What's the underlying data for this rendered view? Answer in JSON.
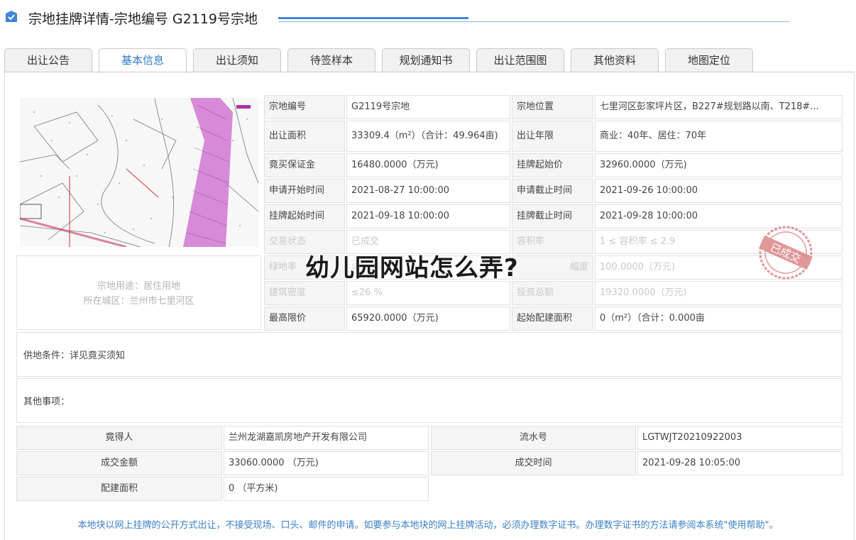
{
  "header": {
    "title": "宗地挂牌详情-宗地编号 G2119号宗地",
    "icon": "checkbox-icon"
  },
  "tabs": [
    {
      "label": "出让公告",
      "active": false
    },
    {
      "label": "基本信息",
      "active": true
    },
    {
      "label": "出让须知",
      "active": false
    },
    {
      "label": "待签样本",
      "active": false
    },
    {
      "label": "规划通知书",
      "active": false
    },
    {
      "label": "出让范围图",
      "active": false
    },
    {
      "label": "其他资料",
      "active": false
    },
    {
      "label": "地图定位",
      "active": false
    }
  ],
  "parcel_info": {
    "use": "宗地用途：居住用地",
    "district": "所在城区：兰州市七里河区"
  },
  "fields": {
    "parcel_no": {
      "label": "宗地编号",
      "value": "G2119号宗地"
    },
    "location": {
      "label": "宗地位置",
      "value": "七里河区彭家坪片区，B227#规划路以南、T218#..."
    },
    "area": {
      "label": "出让面积",
      "value": "33309.4（m²）（合计：49.964亩)"
    },
    "term": {
      "label": "出让年限",
      "value": "商业：40年、居住：70年"
    },
    "deposit": {
      "label": "竟买保证金",
      "value": "16480.0000（万元)"
    },
    "start_price": {
      "label": "挂牌起始价",
      "value": "32960.0000（万元)"
    },
    "apply_start": {
      "label": "申请开始时间",
      "value": "2021-08-27 10:00:00"
    },
    "apply_end": {
      "label": "申请截止时间",
      "value": "2021-09-26 10:00:00"
    },
    "list_start": {
      "label": "挂牌起始时间",
      "value": "2021-09-18 10:00:00"
    },
    "list_end": {
      "label": "挂牌截止时间",
      "value": "2021-09-28 10:00:00"
    },
    "status": {
      "label": "交易状态",
      "value": "已成交"
    },
    "far": {
      "label": "容积率",
      "value": "1 ≤ 容积率 ≤ 2.9"
    },
    "green": {
      "label": "绿地率",
      "value": "≥35 %"
    },
    "increment": {
      "label": "幅度",
      "value": "100.0000（万元)"
    },
    "density": {
      "label": "建筑密度",
      "value": "≤26 %"
    },
    "investment": {
      "label": "投资总额",
      "value": "19320.0000（万元)"
    },
    "max_price": {
      "label": "最高限价",
      "value": "65920.0000（万元)"
    },
    "init_area": {
      "label": "起始配建面积",
      "value": "0（m²）（合计：0.000亩"
    }
  },
  "supply_conditions": "供地条件：详见竟买须知",
  "other_matters": "其他事项：",
  "result": {
    "winner": {
      "label": "竟得人",
      "value": "兰州龙湖嘉凯房地产开发有限公司"
    },
    "serial": {
      "label": "流水号",
      "value": "LGTWJT20210922003"
    },
    "amount": {
      "label": "成交金额",
      "value": "33060.0000 （万元)"
    },
    "deal_time": {
      "label": "成交时间",
      "value": "2021-09-28 10:05:00"
    },
    "alloc_area": {
      "label": "配建面积",
      "value": "0 （平方米)"
    }
  },
  "stamp_text": "已成交",
  "overlay_text": "幼儿园网站怎么弄?",
  "footer_note": "本地块以网上挂牌的公开方式出让，不接受现场、口头、邮件的申请。如要参与本地块的网上挂牌活动，必须办理数字证书。办理数字证书的方法请参阅本系统\"使用帮助\"。",
  "colors": {
    "accent": "#3f86d6",
    "tab_active": "#2f7bc6",
    "stamp": "#c8474a"
  }
}
